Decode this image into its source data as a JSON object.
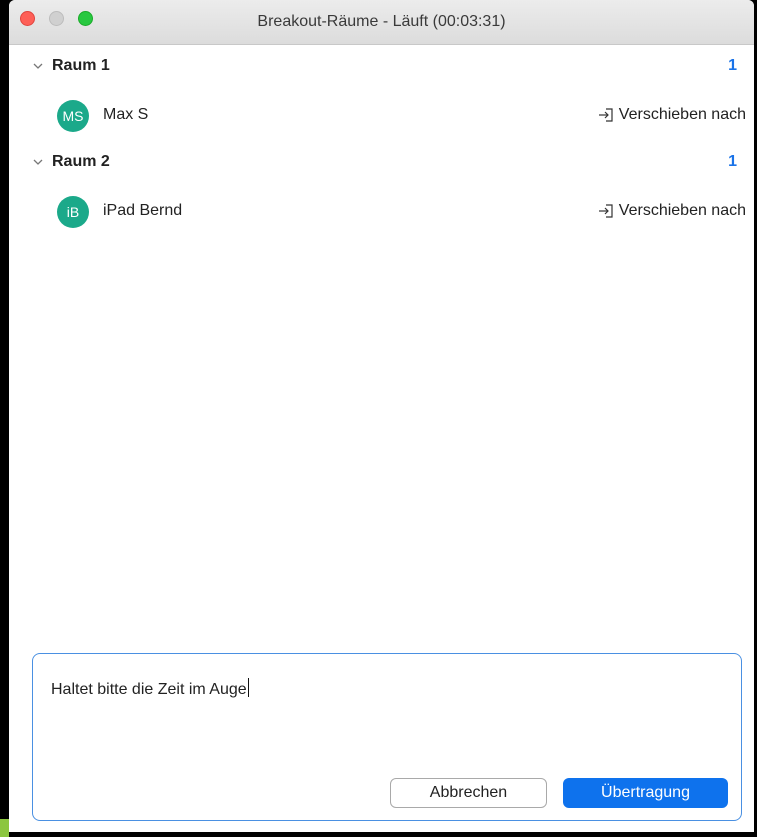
{
  "window": {
    "title": "Breakout-Räume - Läuft (00:03:31)"
  },
  "rooms": [
    {
      "name": "Raum 1",
      "count": "1",
      "members": [
        {
          "initials": "MS",
          "name": "Max S",
          "action": "Verschieben nach"
        }
      ]
    },
    {
      "name": "Raum 2",
      "count": "1",
      "members": [
        {
          "initials": "iB",
          "name": "iPad Bernd",
          "action": "Verschieben nach"
        }
      ]
    }
  ],
  "message": {
    "text": "Haltet bitte die Zeit im Auge",
    "cancel_label": "Abbrechen",
    "send_label": "Übertragung"
  },
  "colors": {
    "accent": "#0e72ed",
    "avatar": "#1ba98a",
    "count": "#1a73e8"
  },
  "icons": {
    "chevron": "chevron-down-icon",
    "move": "move-to-icon"
  }
}
